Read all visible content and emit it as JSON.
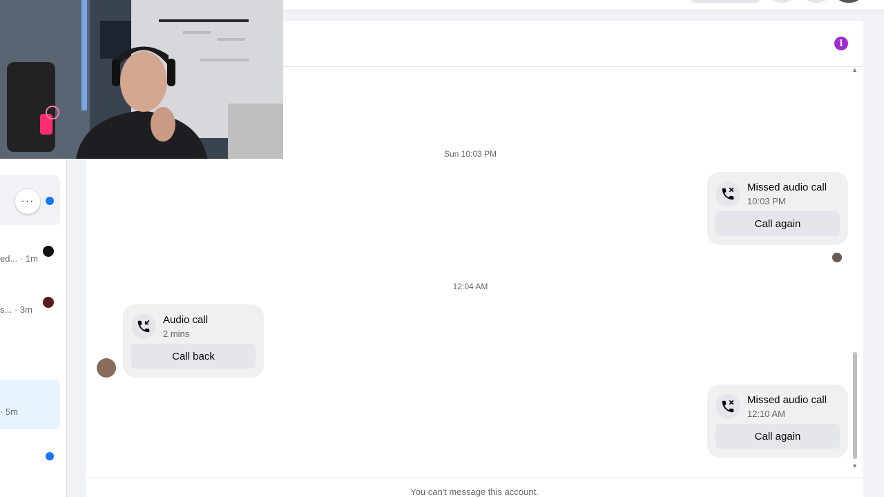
{
  "chat": {
    "timestamps": [
      "Sun 10:03 PM",
      "12:04 AM"
    ],
    "messages": [
      {
        "title": "Missed audio call",
        "subtitle": "10:03 PM",
        "action": "Call again"
      },
      {
        "title": "Audio call",
        "subtitle": "2 mins",
        "action": "Call back"
      },
      {
        "title": "Missed audio call",
        "subtitle": "12:10 AM",
        "action": "Call again"
      }
    ],
    "footer": "You can't message this account.",
    "info_icon": "info-icon",
    "more_label": "···"
  },
  "sidebar": {
    "snippets": [
      {
        "text": "ed... · 1m"
      },
      {
        "text": "s... · 3m"
      },
      {
        "text": "· 5m"
      }
    ]
  },
  "colors": {
    "info": "#a22bd1",
    "unread": "#1877f2",
    "selected_row": "#e7f3ff"
  }
}
